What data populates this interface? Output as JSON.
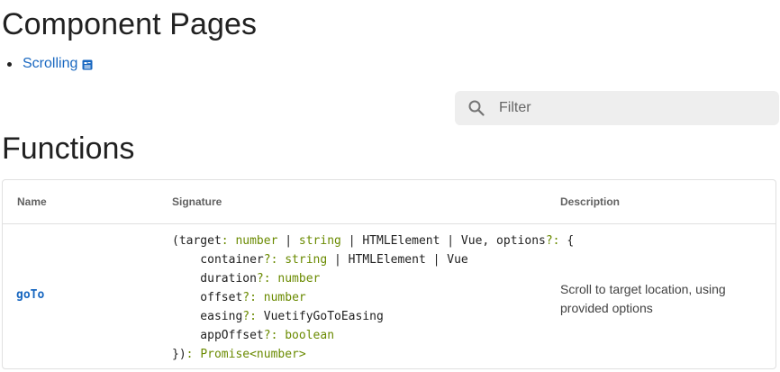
{
  "components": {
    "title": "Component Pages",
    "items": [
      {
        "label": "Scrolling"
      }
    ]
  },
  "filter": {
    "placeholder": "Filter"
  },
  "functions": {
    "title": "Functions",
    "columns": {
      "name": "Name",
      "signature": "Signature",
      "description": "Description"
    },
    "rows": [
      {
        "name": "goTo",
        "signature": [
          [
            [
              "(target",
              "p"
            ],
            [
              ": ",
              "t"
            ],
            [
              "number",
              "t"
            ],
            [
              " | ",
              "p"
            ],
            [
              "string",
              "t"
            ],
            [
              " | HTMLElement | Vue, options",
              "p"
            ],
            [
              "?:",
              "t"
            ],
            [
              " {",
              "p"
            ]
          ],
          [
            [
              "    container",
              "p"
            ],
            [
              "?: ",
              "t"
            ],
            [
              "string",
              "t"
            ],
            [
              " | HTMLElement | Vue",
              "p"
            ]
          ],
          [
            [
              "    duration",
              "p"
            ],
            [
              "?: ",
              "t"
            ],
            [
              "number",
              "t"
            ]
          ],
          [
            [
              "    offset",
              "p"
            ],
            [
              "?: ",
              "t"
            ],
            [
              "number",
              "t"
            ]
          ],
          [
            [
              "    easing",
              "p"
            ],
            [
              "?: ",
              "t"
            ],
            [
              "VuetifyGoToEasing",
              "p"
            ]
          ],
          [
            [
              "    appOffset",
              "p"
            ],
            [
              "?: ",
              "t"
            ],
            [
              "boolean",
              "t"
            ]
          ],
          [
            [
              "})",
              "p"
            ],
            [
              ": ",
              "t"
            ],
            [
              "Promise<number>",
              "t"
            ]
          ]
        ],
        "description": "Scroll to target location, using provided options"
      }
    ]
  },
  "colors": {
    "link": "#1867c0",
    "type": "#6a8a00",
    "filter_bg": "#eeeeee"
  },
  "icons": {
    "external": "open-in-new-icon",
    "search": "search-icon"
  }
}
